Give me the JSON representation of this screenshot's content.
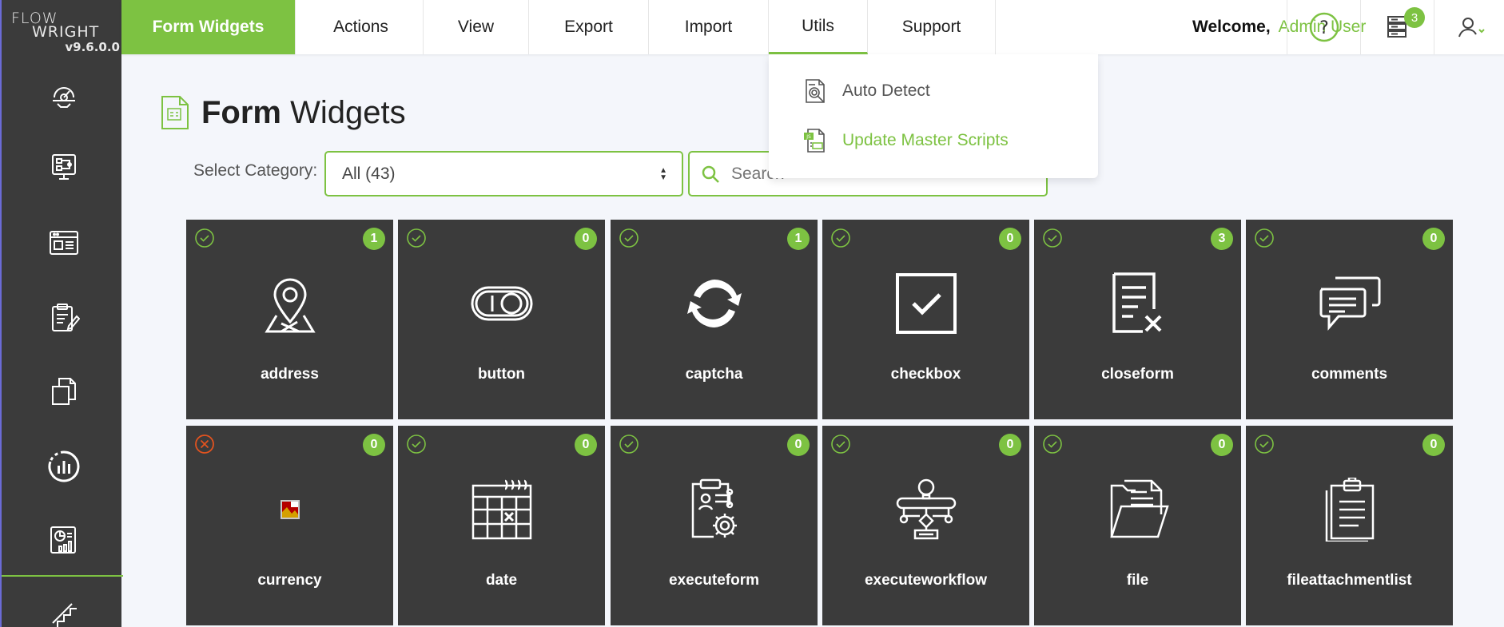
{
  "app": {
    "brand_line1": "FLOW",
    "brand_line2": "WRIGHT",
    "version": "v9.6.0.0"
  },
  "colors": {
    "accent": "#7dc242",
    "sidebar": "#3b3b3b",
    "card": "#3b3b3b",
    "error": "#e2531f"
  },
  "sidebar": {
    "items": [
      {
        "icon": "gear-dashboard-icon"
      },
      {
        "icon": "process-monitor-icon"
      },
      {
        "icon": "browser-window-icon"
      },
      {
        "icon": "clipboard-edit-icon"
      },
      {
        "icon": "document-page-icon"
      },
      {
        "icon": "chart-dial-icon"
      },
      {
        "icon": "report-chart-icon"
      },
      {
        "icon": "stairs-icon"
      }
    ]
  },
  "topnav": {
    "tabs": [
      {
        "label": "Form Widgets",
        "active": true
      },
      {
        "label": "Actions"
      },
      {
        "label": "View"
      },
      {
        "label": "Export"
      },
      {
        "label": "Import"
      },
      {
        "label": "Utils",
        "open": true
      },
      {
        "label": "Support"
      }
    ],
    "welcome_label": "Welcome,",
    "user_name": "Admin User",
    "notifications_count": "3"
  },
  "utils_menu": {
    "items": [
      {
        "label": "Auto Detect",
        "icon": "document-search-icon"
      },
      {
        "label": "Update Master Scripts",
        "icon": "script-file-icon"
      }
    ]
  },
  "page": {
    "title_bold": "Form",
    "title_rest": "Widgets",
    "category_label": "Select Category:",
    "category_value": "All (43)",
    "search_placeholder": "Search"
  },
  "widgets": [
    {
      "name": "address",
      "count": "1",
      "status": "ok",
      "icon": "map-pin-icon"
    },
    {
      "name": "button",
      "count": "0",
      "status": "ok",
      "icon": "toggle-button-icon"
    },
    {
      "name": "captcha",
      "count": "1",
      "status": "ok",
      "icon": "refresh-cycle-icon"
    },
    {
      "name": "checkbox",
      "count": "0",
      "status": "ok",
      "icon": "checkbox-icon"
    },
    {
      "name": "closeform",
      "count": "3",
      "status": "ok",
      "icon": "close-document-icon"
    },
    {
      "name": "comments",
      "count": "0",
      "status": "ok",
      "icon": "chat-bubbles-icon"
    },
    {
      "name": "currency",
      "count": "0",
      "status": "error",
      "icon": "broken-image-icon"
    },
    {
      "name": "date",
      "count": "0",
      "status": "ok",
      "icon": "calendar-icon"
    },
    {
      "name": "executeform",
      "count": "0",
      "status": "ok",
      "icon": "clipboard-gear-icon"
    },
    {
      "name": "executeworkflow",
      "count": "0",
      "status": "ok",
      "icon": "workflow-icon"
    },
    {
      "name": "file",
      "count": "0",
      "status": "ok",
      "icon": "folder-icon"
    },
    {
      "name": "fileattachmentlist",
      "count": "0",
      "status": "ok",
      "icon": "clipboard-list-icon"
    }
  ]
}
